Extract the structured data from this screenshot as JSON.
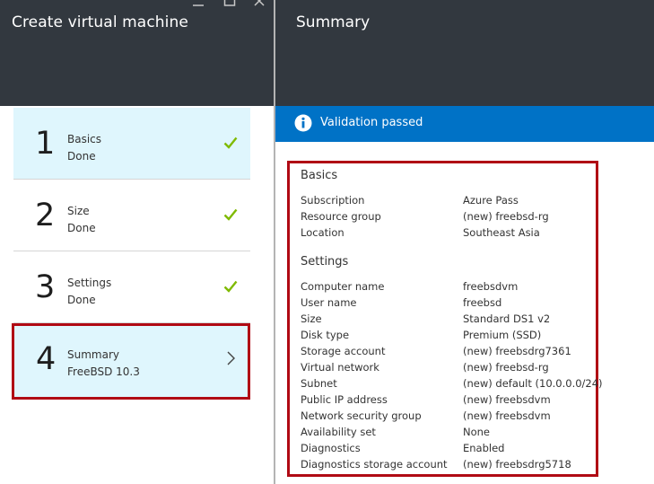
{
  "left_blade": {
    "title": "Create virtual machine",
    "window_controls": [
      "minimize-icon",
      "maximize-icon",
      "close-icon"
    ],
    "steps": [
      {
        "number": "1",
        "title": "Basics",
        "status": "Done",
        "state": "done",
        "icon": "checkmark-icon"
      },
      {
        "number": "2",
        "title": "Size",
        "status": "Done",
        "state": "done",
        "icon": "checkmark-icon"
      },
      {
        "number": "3",
        "title": "Settings",
        "status": "Done",
        "state": "done",
        "icon": "checkmark-icon"
      },
      {
        "number": "4",
        "title": "Summary",
        "status": "FreeBSD 10.3",
        "state": "active",
        "icon": "chevron-right-icon"
      }
    ]
  },
  "right_blade": {
    "title": "Summary",
    "validation": {
      "icon": "info-icon",
      "text": "Validation passed"
    },
    "sections": [
      {
        "title": "Basics",
        "rows": [
          {
            "key": "Subscription",
            "value": "Azure Pass"
          },
          {
            "key": "Resource group",
            "value": "(new) freebsd-rg"
          },
          {
            "key": "Location",
            "value": "Southeast Asia"
          }
        ]
      },
      {
        "title": "Settings",
        "rows": [
          {
            "key": "Computer name",
            "value": "freebsdvm"
          },
          {
            "key": "User name",
            "value": "freebsd"
          },
          {
            "key": "Size",
            "value": "Standard DS1 v2"
          },
          {
            "key": "Disk type",
            "value": "Premium (SSD)"
          },
          {
            "key": "Storage account",
            "value": "(new) freebsdrg7361"
          },
          {
            "key": "Virtual network",
            "value": "(new) freebsd-rg"
          },
          {
            "key": "Subnet",
            "value": "(new) default (10.0.0.0/24)"
          },
          {
            "key": "Public IP address",
            "value": "(new) freebsdvm"
          },
          {
            "key": "Network security group",
            "value": "(new) freebsdvm"
          },
          {
            "key": "Availability set",
            "value": "None"
          },
          {
            "key": "Diagnostics",
            "value": "Enabled"
          },
          {
            "key": "Diagnostics storage account",
            "value": "(new) freebsdrg5718"
          }
        ]
      }
    ]
  },
  "colors": {
    "header_bg": "#32383f",
    "accent_blue": "#0072c6",
    "check_green": "#7fba00",
    "highlight_red": "#b00a14",
    "step_done_bg": "#dff6fd"
  }
}
